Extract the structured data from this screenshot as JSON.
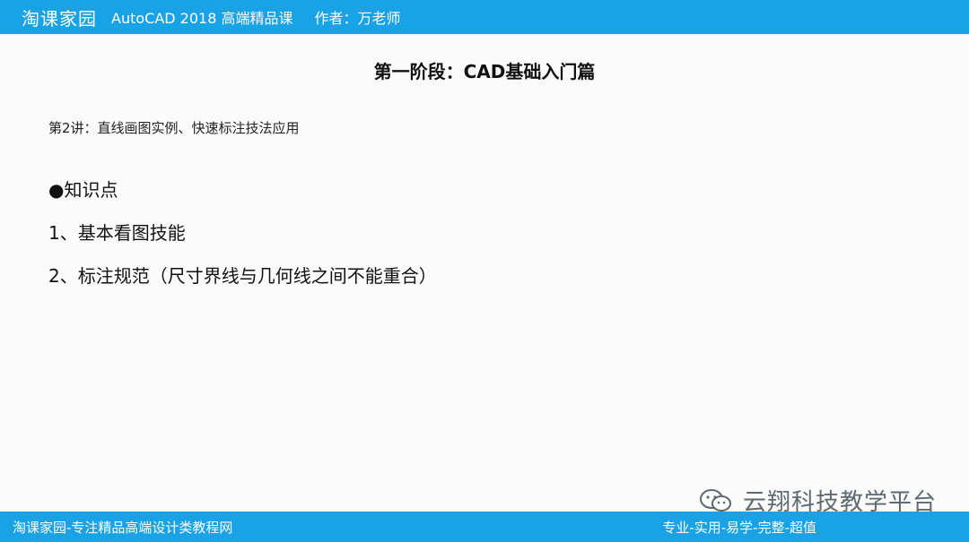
{
  "header": {
    "brand": "淘课家园",
    "course": "AutoCAD 2018  高端精品课",
    "author": "作者：万老师"
  },
  "slide": {
    "stage_title": "第一阶段：CAD基础入门篇",
    "lesson": "第2讲：直线画图实例、快速标注技法应用",
    "knowledge_heading": "●知识点",
    "items": [
      "1、基本看图技能",
      "2、标注规范（尺寸界线与几何线之间不能重合）"
    ]
  },
  "watermark": {
    "icon": "wechat-icon",
    "text": "云翔科技教学平台"
  },
  "footer": {
    "left": "淘课家园-专注精品高端设计类教程网",
    "right": "专业-实用-易学-完整-超值"
  },
  "colors": {
    "bar": "#19a2e6",
    "background": "#fafbfa",
    "watermark": "#5d6a70"
  }
}
